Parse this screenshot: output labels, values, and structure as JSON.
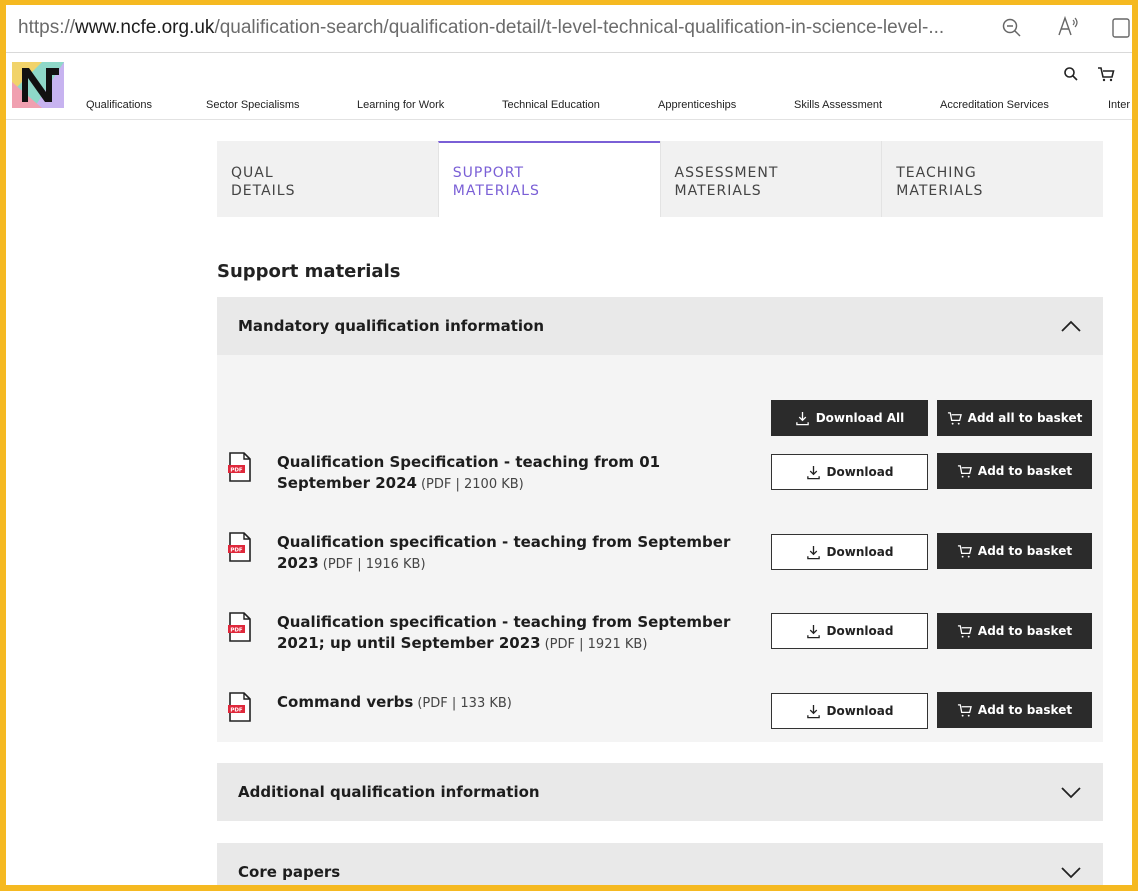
{
  "browser": {
    "url_prefix": "https://",
    "url_host": "www.ncfe.org.uk",
    "url_path": "/qualification-search/qualification-detail/t-level-technical-qualification-in-science-level-...",
    "zoom_icon": "zoom-out-icon",
    "read_aloud_icon": "read-aloud-icon",
    "reader_icon": "reader-view-icon"
  },
  "header": {
    "nav": [
      "Qualifications",
      "Sector Specialisms",
      "Learning for Work",
      "Technical Education",
      "Apprenticeships",
      "Skills Assessment",
      "Accreditation Services",
      "Inter"
    ],
    "search_icon": "search-icon",
    "basket_icon": "basket-icon"
  },
  "tabs": [
    {
      "line1": "QUAL",
      "line2": "DETAILS",
      "active": false
    },
    {
      "line1": "SUPPORT",
      "line2": "MATERIALS",
      "active": true
    },
    {
      "line1": "ASSESSMENT",
      "line2": "MATERIALS",
      "active": false
    },
    {
      "line1": "TEACHING",
      "line2": "MATERIALS",
      "active": false
    }
  ],
  "section_title": "Support materials",
  "accordions": {
    "mandatory": {
      "label": "Mandatory qualification information",
      "expanded": true
    },
    "additional": {
      "label": "Additional qualification information",
      "expanded": false
    },
    "core": {
      "label": "Core papers",
      "expanded": false
    }
  },
  "bulk": {
    "download_all": "Download All",
    "add_all": "Add all to basket"
  },
  "documents": [
    {
      "title": "Qualification Specification - teaching from 01 September 2024",
      "meta": "(PDF | 2100 KB)"
    },
    {
      "title": "Qualification specification - teaching from September 2023",
      "meta": "(PDF | 1916 KB)"
    },
    {
      "title": "Qualification specification - teaching from September 2021; up until September 2023",
      "meta": "(PDF | 1921 KB)"
    },
    {
      "title": "Command verbs",
      "meta": "(PDF | 133 KB)"
    }
  ],
  "doc_buttons": {
    "download": "Download",
    "add": "Add to basket"
  },
  "pdf_label": "PDF",
  "colors": {
    "accent": "#7a5fd6",
    "frame": "#f5b921",
    "dark_button": "#2b2b2b",
    "pdf_red": "#e0283b"
  }
}
